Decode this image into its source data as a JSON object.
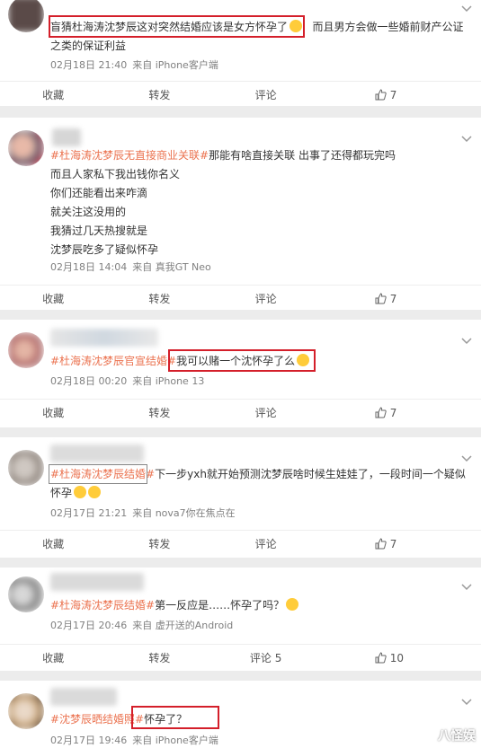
{
  "posts": [
    {
      "lines": [
        {
          "topic": "",
          "text": "盲猜杜海涛沈梦辰这对突然结婚应该是女方怀孕了",
          "emoji": true,
          "rest": "而且男方会做一些婚前财产公证"
        },
        {
          "topic": "",
          "text": "之类的保证利益"
        }
      ],
      "date": "02月18日 21:40",
      "source": "来自 iPhone客户端",
      "actions": {
        "collect": "收藏",
        "repost": "转发",
        "comment": "评论",
        "likes": "7"
      }
    },
    {
      "lines": [
        {
          "topic": "#杜海涛沈梦辰无直接商业关联#",
          "text": "那能有啥直接关联 出事了还得都玩完吗"
        },
        {
          "topic": "",
          "text": "而且人家私下我出钱你名义"
        },
        {
          "topic": "",
          "text": "你们还能看出来咋滴"
        },
        {
          "topic": "",
          "text": "就关注这没用的"
        },
        {
          "topic": "",
          "text": "我猜过几天热搜就是"
        },
        {
          "topic": "",
          "text": "沈梦辰吃多了疑似怀孕"
        }
      ],
      "date": "02月18日 14:04",
      "source": "来自 真我GT Neo",
      "actions": {
        "collect": "收藏",
        "repost": "转发",
        "comment": "评论",
        "likes": "7"
      }
    },
    {
      "lines": [
        {
          "topic": "#杜海涛沈梦辰官宣结婚#",
          "text": "我可以赌一个沈怀孕了么",
          "emoji": true
        }
      ],
      "date": "02月18日 00:20",
      "source": "来自 iPhone 13",
      "actions": {
        "collect": "收藏",
        "repost": "转发",
        "comment": "评论",
        "likes": "7"
      }
    },
    {
      "lines": [
        {
          "topic": "#杜海涛沈梦辰结婚#",
          "text": "下一步yxh就开始预测沈梦辰啥时候生娃娃了，一段时间一个疑似"
        },
        {
          "topic": "",
          "text": "怀孕",
          "emoji2": true
        }
      ],
      "date": "02月17日 21:21",
      "source": "来自 nova7你在焦点在",
      "actions": {
        "collect": "收藏",
        "repost": "转发",
        "comment": "评论",
        "likes": "7"
      }
    },
    {
      "lines": [
        {
          "topic": "#杜海涛沈梦辰结婚#",
          "text": "第一反应是……怀孕了吗？",
          "emoji": true
        }
      ],
      "date": "02月17日 20:46",
      "source": "来自 虚开送的Android",
      "actions": {
        "collect": "收藏",
        "repost": "转发",
        "comment": "评论 5",
        "likes": "10"
      }
    },
    {
      "lines": [
        {
          "topic": "#沈梦辰晒结婚照#",
          "text": "怀孕了？"
        }
      ],
      "date": "02月17日 19:46",
      "source": "来自 iPhone客户端",
      "actions": {}
    }
  ],
  "watermark": "八怪娱",
  "colors": {
    "topic": "#eb7350",
    "highlight": "#d41f2a"
  }
}
